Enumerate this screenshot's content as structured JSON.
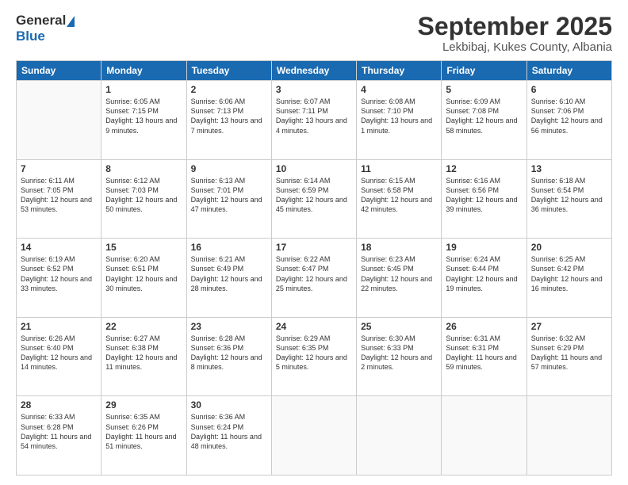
{
  "header": {
    "logo_general": "General",
    "logo_blue": "Blue",
    "title": "September 2025",
    "subtitle": "Lekbibaj, Kukes County, Albania"
  },
  "days_of_week": [
    "Sunday",
    "Monday",
    "Tuesday",
    "Wednesday",
    "Thursday",
    "Friday",
    "Saturday"
  ],
  "weeks": [
    [
      {
        "day": "",
        "sunrise": "",
        "sunset": "",
        "daylight": ""
      },
      {
        "day": "1",
        "sunrise": "Sunrise: 6:05 AM",
        "sunset": "Sunset: 7:15 PM",
        "daylight": "Daylight: 13 hours and 9 minutes."
      },
      {
        "day": "2",
        "sunrise": "Sunrise: 6:06 AM",
        "sunset": "Sunset: 7:13 PM",
        "daylight": "Daylight: 13 hours and 7 minutes."
      },
      {
        "day": "3",
        "sunrise": "Sunrise: 6:07 AM",
        "sunset": "Sunset: 7:11 PM",
        "daylight": "Daylight: 13 hours and 4 minutes."
      },
      {
        "day": "4",
        "sunrise": "Sunrise: 6:08 AM",
        "sunset": "Sunset: 7:10 PM",
        "daylight": "Daylight: 13 hours and 1 minute."
      },
      {
        "day": "5",
        "sunrise": "Sunrise: 6:09 AM",
        "sunset": "Sunset: 7:08 PM",
        "daylight": "Daylight: 12 hours and 58 minutes."
      },
      {
        "day": "6",
        "sunrise": "Sunrise: 6:10 AM",
        "sunset": "Sunset: 7:06 PM",
        "daylight": "Daylight: 12 hours and 56 minutes."
      }
    ],
    [
      {
        "day": "7",
        "sunrise": "Sunrise: 6:11 AM",
        "sunset": "Sunset: 7:05 PM",
        "daylight": "Daylight: 12 hours and 53 minutes."
      },
      {
        "day": "8",
        "sunrise": "Sunrise: 6:12 AM",
        "sunset": "Sunset: 7:03 PM",
        "daylight": "Daylight: 12 hours and 50 minutes."
      },
      {
        "day": "9",
        "sunrise": "Sunrise: 6:13 AM",
        "sunset": "Sunset: 7:01 PM",
        "daylight": "Daylight: 12 hours and 47 minutes."
      },
      {
        "day": "10",
        "sunrise": "Sunrise: 6:14 AM",
        "sunset": "Sunset: 6:59 PM",
        "daylight": "Daylight: 12 hours and 45 minutes."
      },
      {
        "day": "11",
        "sunrise": "Sunrise: 6:15 AM",
        "sunset": "Sunset: 6:58 PM",
        "daylight": "Daylight: 12 hours and 42 minutes."
      },
      {
        "day": "12",
        "sunrise": "Sunrise: 6:16 AM",
        "sunset": "Sunset: 6:56 PM",
        "daylight": "Daylight: 12 hours and 39 minutes."
      },
      {
        "day": "13",
        "sunrise": "Sunrise: 6:18 AM",
        "sunset": "Sunset: 6:54 PM",
        "daylight": "Daylight: 12 hours and 36 minutes."
      }
    ],
    [
      {
        "day": "14",
        "sunrise": "Sunrise: 6:19 AM",
        "sunset": "Sunset: 6:52 PM",
        "daylight": "Daylight: 12 hours and 33 minutes."
      },
      {
        "day": "15",
        "sunrise": "Sunrise: 6:20 AM",
        "sunset": "Sunset: 6:51 PM",
        "daylight": "Daylight: 12 hours and 30 minutes."
      },
      {
        "day": "16",
        "sunrise": "Sunrise: 6:21 AM",
        "sunset": "Sunset: 6:49 PM",
        "daylight": "Daylight: 12 hours and 28 minutes."
      },
      {
        "day": "17",
        "sunrise": "Sunrise: 6:22 AM",
        "sunset": "Sunset: 6:47 PM",
        "daylight": "Daylight: 12 hours and 25 minutes."
      },
      {
        "day": "18",
        "sunrise": "Sunrise: 6:23 AM",
        "sunset": "Sunset: 6:45 PM",
        "daylight": "Daylight: 12 hours and 22 minutes."
      },
      {
        "day": "19",
        "sunrise": "Sunrise: 6:24 AM",
        "sunset": "Sunset: 6:44 PM",
        "daylight": "Daylight: 12 hours and 19 minutes."
      },
      {
        "day": "20",
        "sunrise": "Sunrise: 6:25 AM",
        "sunset": "Sunset: 6:42 PM",
        "daylight": "Daylight: 12 hours and 16 minutes."
      }
    ],
    [
      {
        "day": "21",
        "sunrise": "Sunrise: 6:26 AM",
        "sunset": "Sunset: 6:40 PM",
        "daylight": "Daylight: 12 hours and 14 minutes."
      },
      {
        "day": "22",
        "sunrise": "Sunrise: 6:27 AM",
        "sunset": "Sunset: 6:38 PM",
        "daylight": "Daylight: 12 hours and 11 minutes."
      },
      {
        "day": "23",
        "sunrise": "Sunrise: 6:28 AM",
        "sunset": "Sunset: 6:36 PM",
        "daylight": "Daylight: 12 hours and 8 minutes."
      },
      {
        "day": "24",
        "sunrise": "Sunrise: 6:29 AM",
        "sunset": "Sunset: 6:35 PM",
        "daylight": "Daylight: 12 hours and 5 minutes."
      },
      {
        "day": "25",
        "sunrise": "Sunrise: 6:30 AM",
        "sunset": "Sunset: 6:33 PM",
        "daylight": "Daylight: 12 hours and 2 minutes."
      },
      {
        "day": "26",
        "sunrise": "Sunrise: 6:31 AM",
        "sunset": "Sunset: 6:31 PM",
        "daylight": "Daylight: 11 hours and 59 minutes."
      },
      {
        "day": "27",
        "sunrise": "Sunrise: 6:32 AM",
        "sunset": "Sunset: 6:29 PM",
        "daylight": "Daylight: 11 hours and 57 minutes."
      }
    ],
    [
      {
        "day": "28",
        "sunrise": "Sunrise: 6:33 AM",
        "sunset": "Sunset: 6:28 PM",
        "daylight": "Daylight: 11 hours and 54 minutes."
      },
      {
        "day": "29",
        "sunrise": "Sunrise: 6:35 AM",
        "sunset": "Sunset: 6:26 PM",
        "daylight": "Daylight: 11 hours and 51 minutes."
      },
      {
        "day": "30",
        "sunrise": "Sunrise: 6:36 AM",
        "sunset": "Sunset: 6:24 PM",
        "daylight": "Daylight: 11 hours and 48 minutes."
      },
      {
        "day": "",
        "sunrise": "",
        "sunset": "",
        "daylight": ""
      },
      {
        "day": "",
        "sunrise": "",
        "sunset": "",
        "daylight": ""
      },
      {
        "day": "",
        "sunrise": "",
        "sunset": "",
        "daylight": ""
      },
      {
        "day": "",
        "sunrise": "",
        "sunset": "",
        "daylight": ""
      }
    ]
  ]
}
